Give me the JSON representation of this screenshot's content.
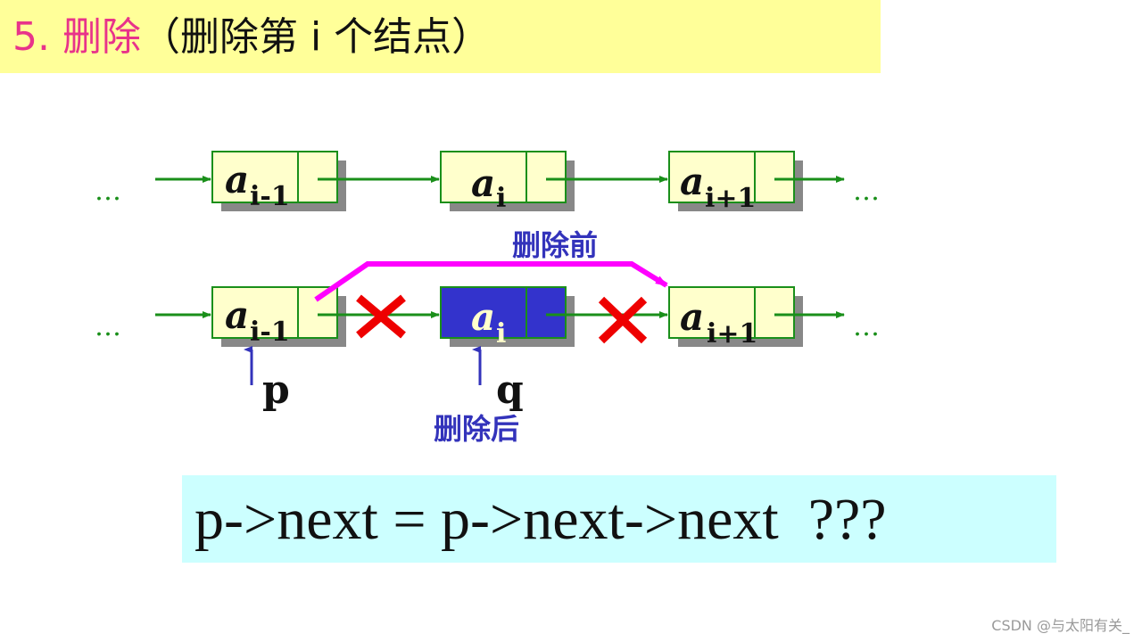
{
  "title": {
    "number": "5.",
    "keyword": "删除",
    "subtitle": "（删除第 i 个结点）"
  },
  "diagram": {
    "before_row": {
      "leading_dots": "…",
      "trailing_dots": "…",
      "nodes": [
        {
          "base": "a",
          "sub": "i-1"
        },
        {
          "base": "a",
          "sub": "i"
        },
        {
          "base": "a",
          "sub": "i+1"
        }
      ]
    },
    "after_row": {
      "leading_dots": "…",
      "trailing_dots": "…",
      "nodes": [
        {
          "base": "a",
          "sub": "i-1"
        },
        {
          "base": "a",
          "sub": "i",
          "highlighted": true
        },
        {
          "base": "a",
          "sub": "i+1"
        }
      ]
    },
    "label_before": "删除前",
    "label_after": "删除后",
    "pointer_p": "p",
    "pointer_q": "q",
    "cross_mark": "×"
  },
  "code": "p->next = p->next->next  ???",
  "watermark": "CSDN @与太阳有关_",
  "colors": {
    "title_bg": "#ffff99",
    "title_accent": "#e8338a",
    "node_fill": "#ffffcc",
    "node_border": "#1a8f1a",
    "node_shadow": "#888888",
    "arrow_green": "#1a8f1a",
    "highlight_node": "#3333cc",
    "bypass_magenta": "#ff00ff",
    "cross_red": "#ee0000",
    "label_blue": "#3333bb",
    "code_bg": "#ccffff"
  }
}
